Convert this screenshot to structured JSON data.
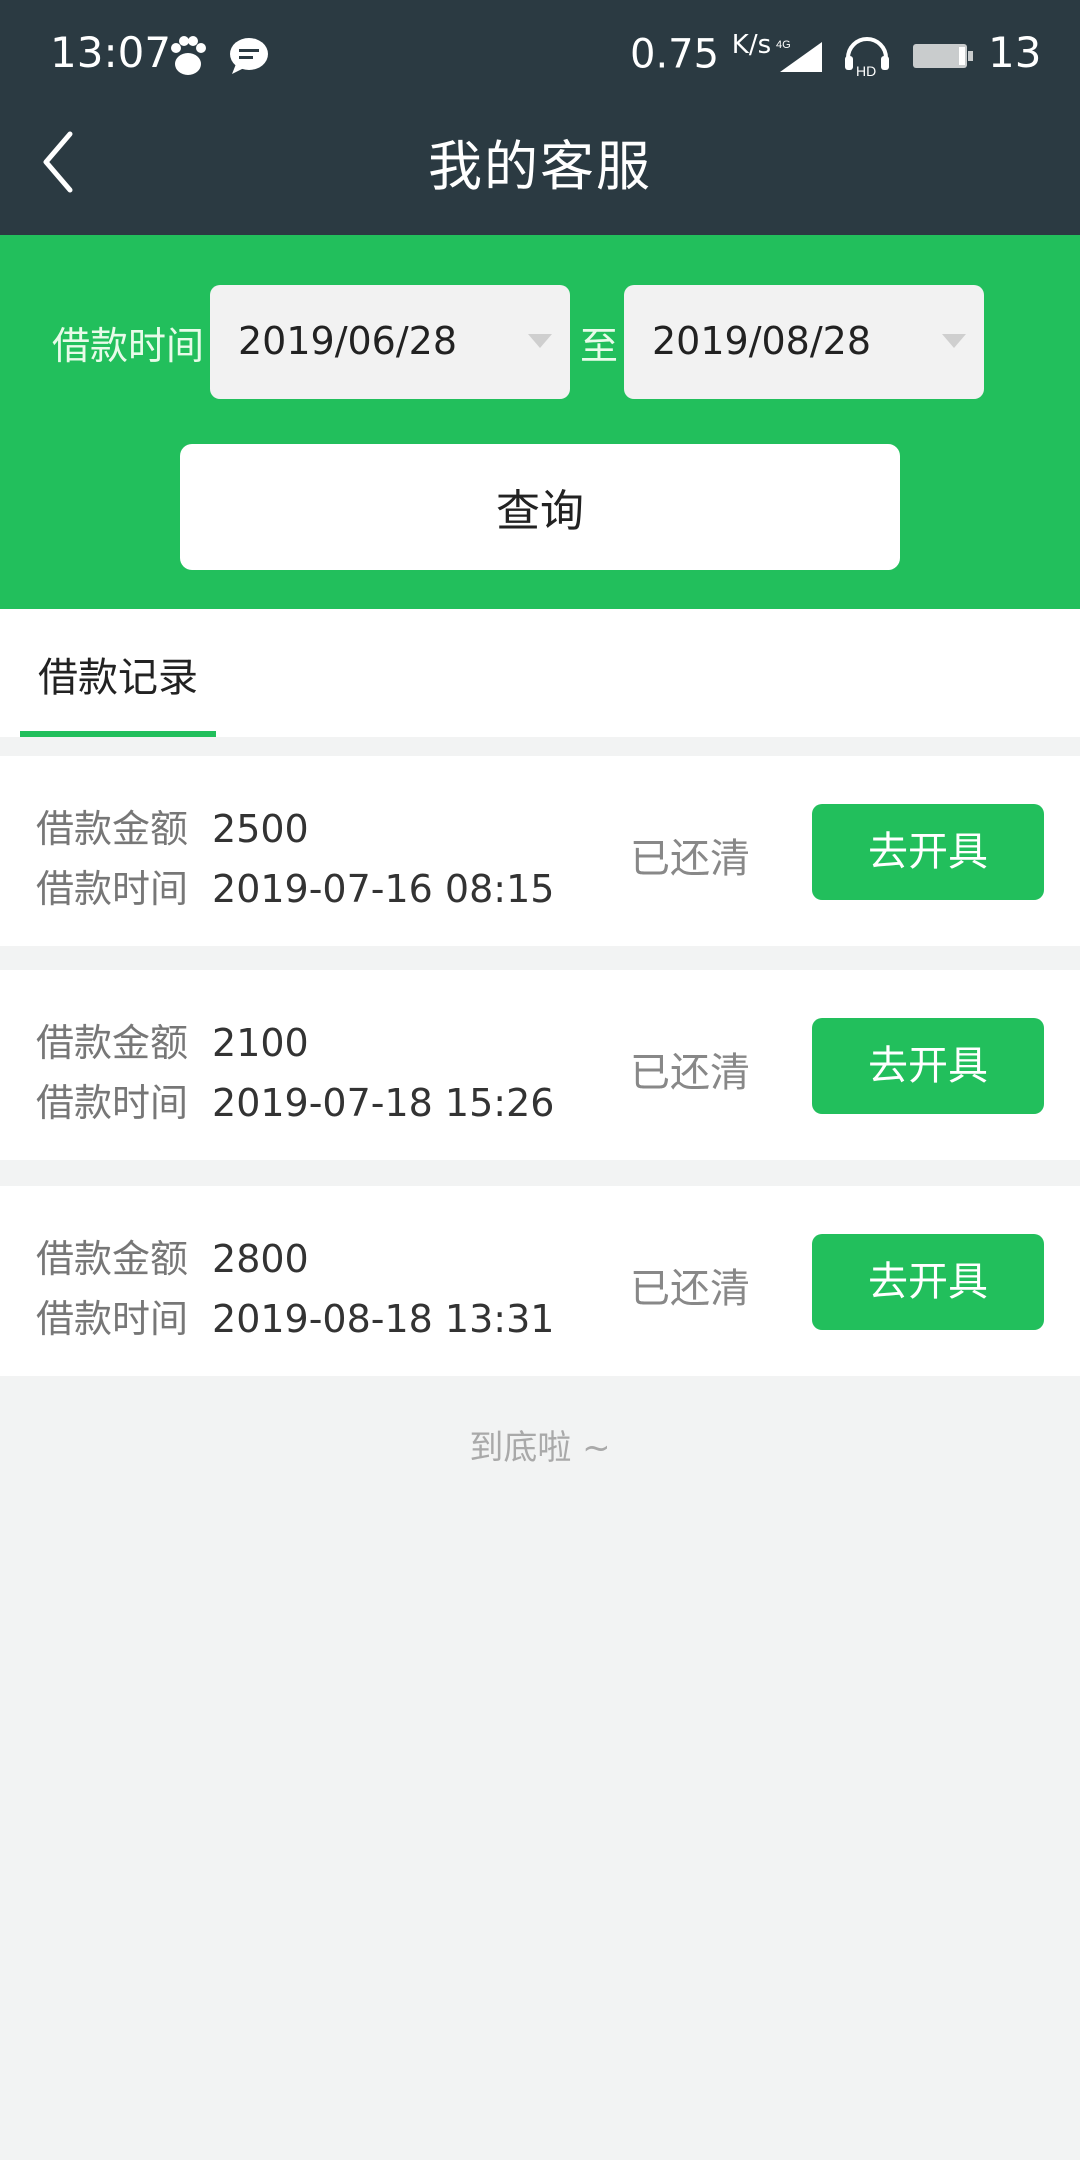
{
  "status_bar": {
    "time": "13:07",
    "net_speed": "0.75",
    "net_unit": "K/s",
    "signal_text": "4G",
    "hd_text": "HD",
    "battery_level": "13"
  },
  "header": {
    "title": "我的客服"
  },
  "filter": {
    "label": "借款时间",
    "from_date": "2019/06/28",
    "separator": "至",
    "to_date": "2019/08/28",
    "query_label": "查询"
  },
  "tabs": [
    {
      "label": "借款记录",
      "active": true
    }
  ],
  "records": [
    {
      "amount_label": "借款金额",
      "amount": "2500",
      "time_label": "借款时间",
      "time": "2019-07-16  08:15",
      "status": "已还清",
      "action": "去开具"
    },
    {
      "amount_label": "借款金额",
      "amount": "2100",
      "time_label": "借款时间",
      "time": "2019-07-18  15:26",
      "status": "已还清",
      "action": "去开具"
    },
    {
      "amount_label": "借款金额",
      "amount": "2800",
      "time_label": "借款时间",
      "time": "2019-08-18  13:31",
      "status": "已还清",
      "action": "去开具"
    }
  ],
  "end_note": "到底啦 ~",
  "colors": {
    "header_bg": "#2b3a42",
    "accent_green": "#22bf5c",
    "page_bg": "#f2f3f3"
  }
}
